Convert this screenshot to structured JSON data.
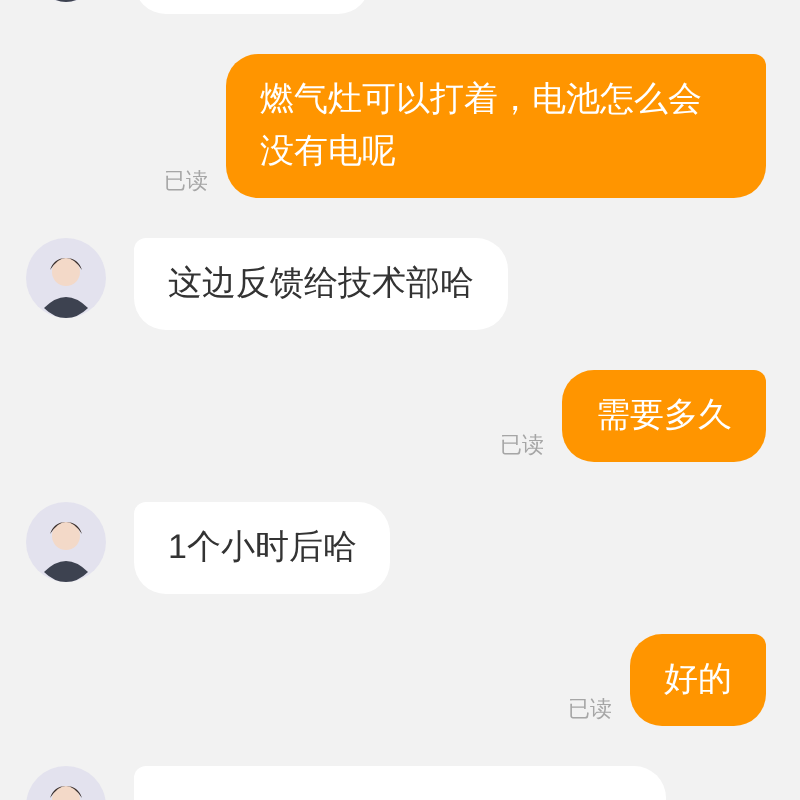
{
  "messages": [
    {
      "kind": "incoming"
    },
    {
      "kind": "outgoing",
      "text": "燃气灶可以打着，电池怎么会没有电呢",
      "read_label": "已读"
    },
    {
      "kind": "incoming",
      "text": "这边反馈给技术部哈"
    },
    {
      "kind": "outgoing",
      "text": "需要多久",
      "read_label": "已读"
    },
    {
      "kind": "incoming",
      "text": "1个小时后哈"
    },
    {
      "kind": "outgoing",
      "text": "好的",
      "read_label": "已读"
    },
    {
      "kind": "incoming"
    }
  ]
}
